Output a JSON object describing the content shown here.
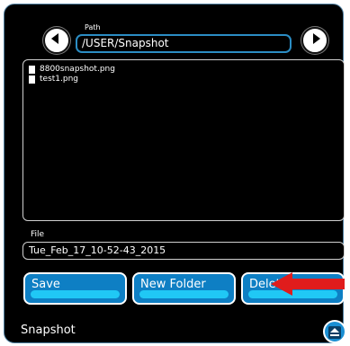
{
  "header": {
    "path_label": "Path",
    "path_value": "/USER/Snapshot"
  },
  "files": [
    {
      "name": "8800snapshot.png",
      "icon": "file-icon"
    },
    {
      "name": "test1.png",
      "icon": "file-icon"
    }
  ],
  "file_field": {
    "label": "File",
    "value": "Tue_Feb_17_10-52-43_2015"
  },
  "actions": {
    "save_label": "Save",
    "new_folder_label": "New Folder",
    "delete_label": "Delete"
  },
  "footer": {
    "title": "Snapshot"
  },
  "icons": {
    "back": "arrow-left-icon",
    "forward": "arrow-right-icon",
    "eject": "eject-icon",
    "annotation": "red-arrow-icon"
  },
  "colors": {
    "background": "#000000",
    "button": "#0e7fc4",
    "button_highlight": "#20c8f5",
    "path_border": "#2b8dc4",
    "annotation_arrow": "#e01c1c"
  }
}
